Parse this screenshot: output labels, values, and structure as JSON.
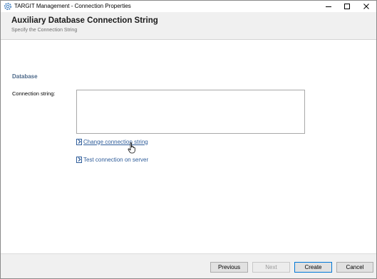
{
  "window": {
    "title": "TARGIT Management - Connection Properties",
    "controls": [
      "minimize-icon",
      "maximize-icon",
      "close-icon"
    ]
  },
  "header": {
    "title": "Auxiliary Database Connection String",
    "subtitle": "Specify the Connection String"
  },
  "form": {
    "section_heading": "Database",
    "connection_label": "Connection string:",
    "connection_value": ""
  },
  "links": {
    "change": "Change connection string",
    "test": "Test connection on server"
  },
  "footer": {
    "previous": "Previous",
    "next": "Next",
    "create": "Create",
    "cancel": "Cancel"
  },
  "colors": {
    "link": "#2f5d9a",
    "section_heading": "#4e6a8a",
    "default_button_border": "#0078d7"
  }
}
